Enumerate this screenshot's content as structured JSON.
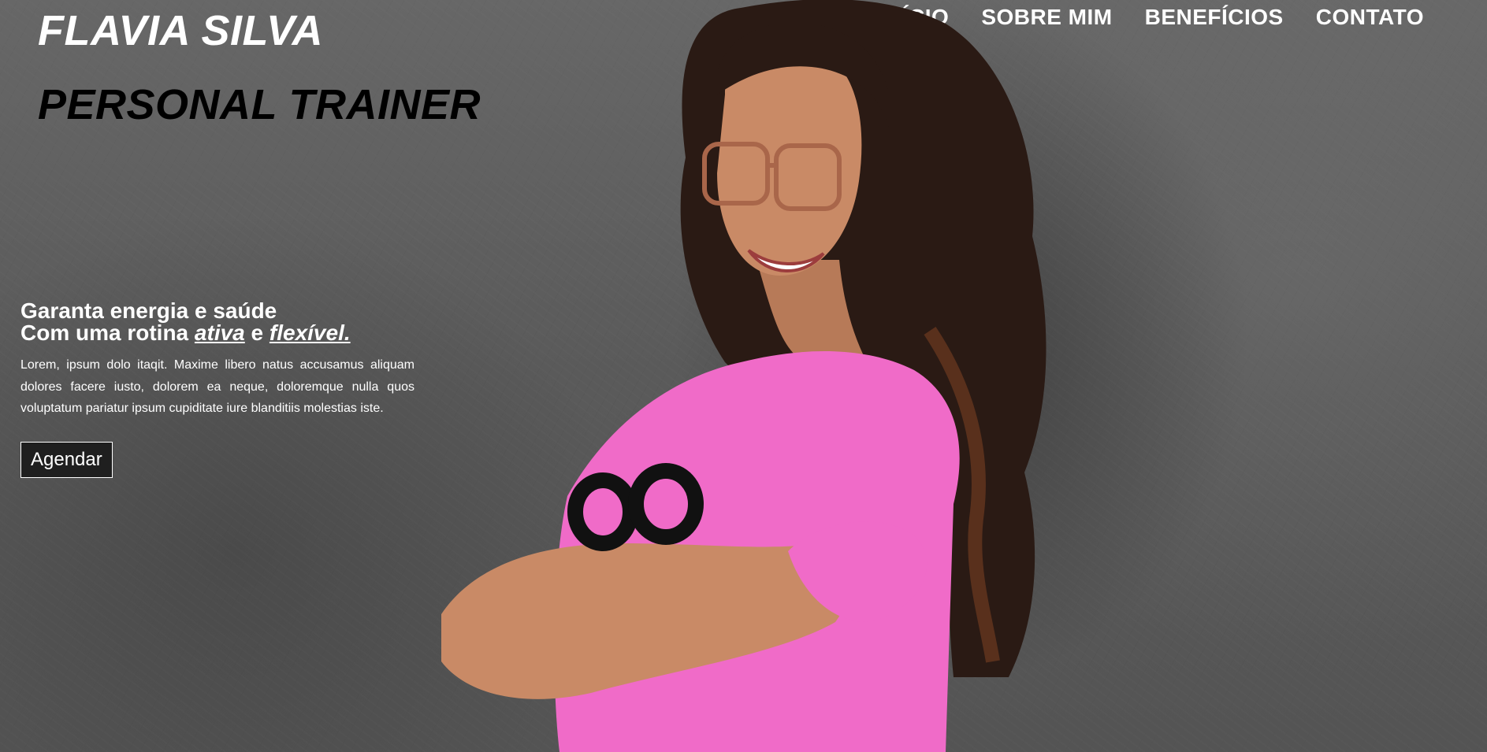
{
  "brand": {
    "name": "FLAVIA SILVA",
    "role": "PERSONAL TRAINER"
  },
  "nav": {
    "items": [
      "INÍCIO",
      "SOBRE MIM",
      "BENEFÍCIOS",
      "CONTATO"
    ]
  },
  "hero": {
    "headline_line1": "Garanta energia e saúde",
    "headline_prefix": "Com uma rotina ",
    "headline_word1": "ativa",
    "headline_and": " e ",
    "headline_word2": "flexível.",
    "body": "Lorem, ipsum dolo itaqit. Maxime libero natus accusamus aliquam dolores facere iusto, dolorem ea neque, doloremque nulla quos voluptatum pariatur ipsum cupiditate iure blanditiis molestias iste.",
    "cta_label": "Agendar"
  },
  "colors": {
    "background": "#5e5e5e",
    "shirt": "#f06bc8",
    "hair": "#2a1a14",
    "skin": "#c98a66",
    "button": "#1f1f1f"
  },
  "icons": [
    "infinity-logo-on-shirt"
  ]
}
